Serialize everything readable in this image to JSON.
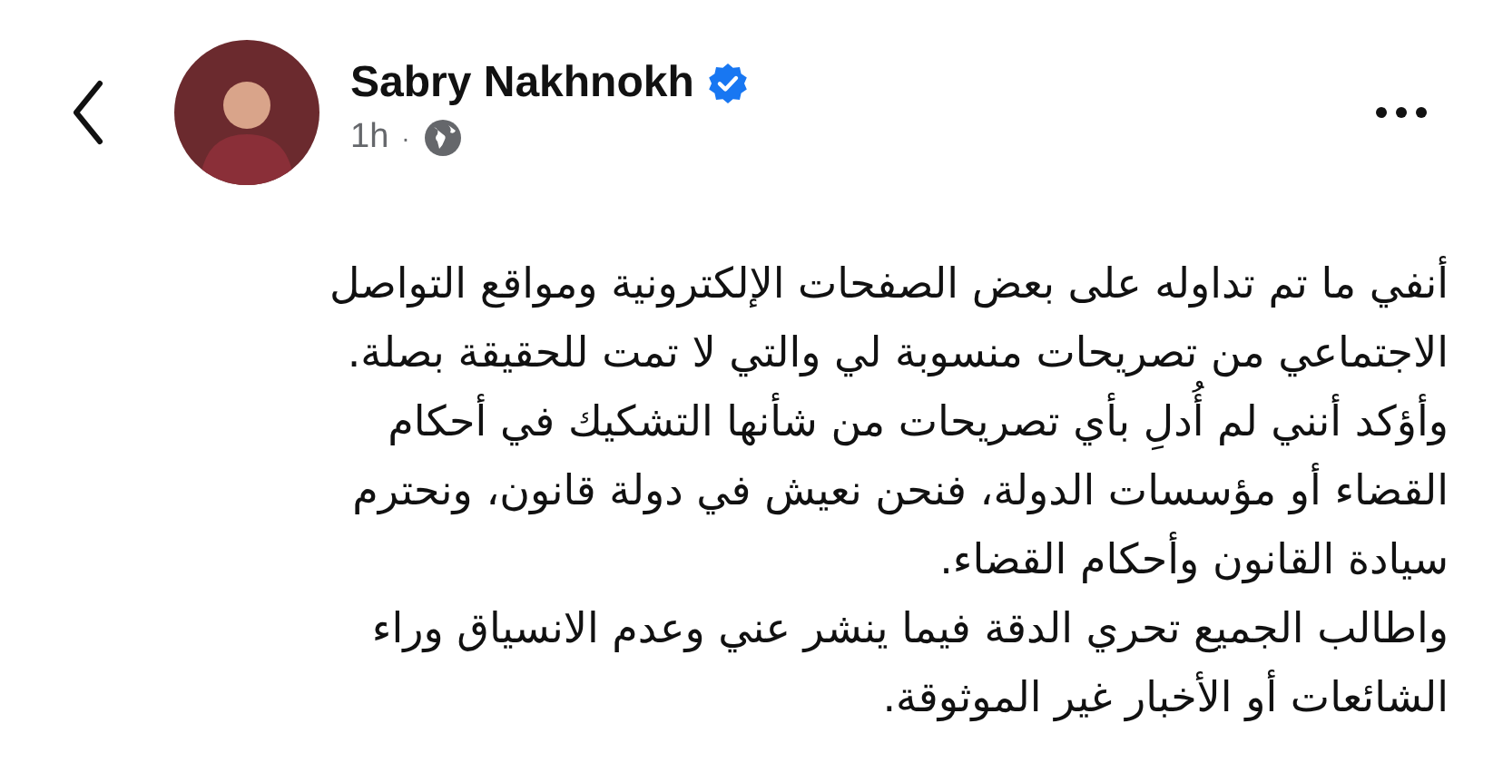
{
  "post": {
    "author": "Sabry Nakhnokh",
    "verified": true,
    "time": "1h",
    "separator": "·",
    "body_lines": [
      "أنفي ما تم تداوله على بعض الصفحات الإلكترونية ومواقع التواصل",
      "الاجتماعي من تصريحات منسوبة لي والتي لا تمت للحقيقة بصلة.",
      "وأؤكد أنني لم أُدلِ بأي تصريحات من شأنها التشكيك في أحكام",
      "القضاء أو مؤسسات الدولة، فنحن نعيش في دولة قانون، ونحترم",
      "سيادة القانون وأحكام القضاء.",
      "واطالب الجميع تحري الدقة فيما ينشر عني وعدم الانسياق وراء",
      "الشائعات أو الأخبار غير الموثوقة."
    ]
  }
}
